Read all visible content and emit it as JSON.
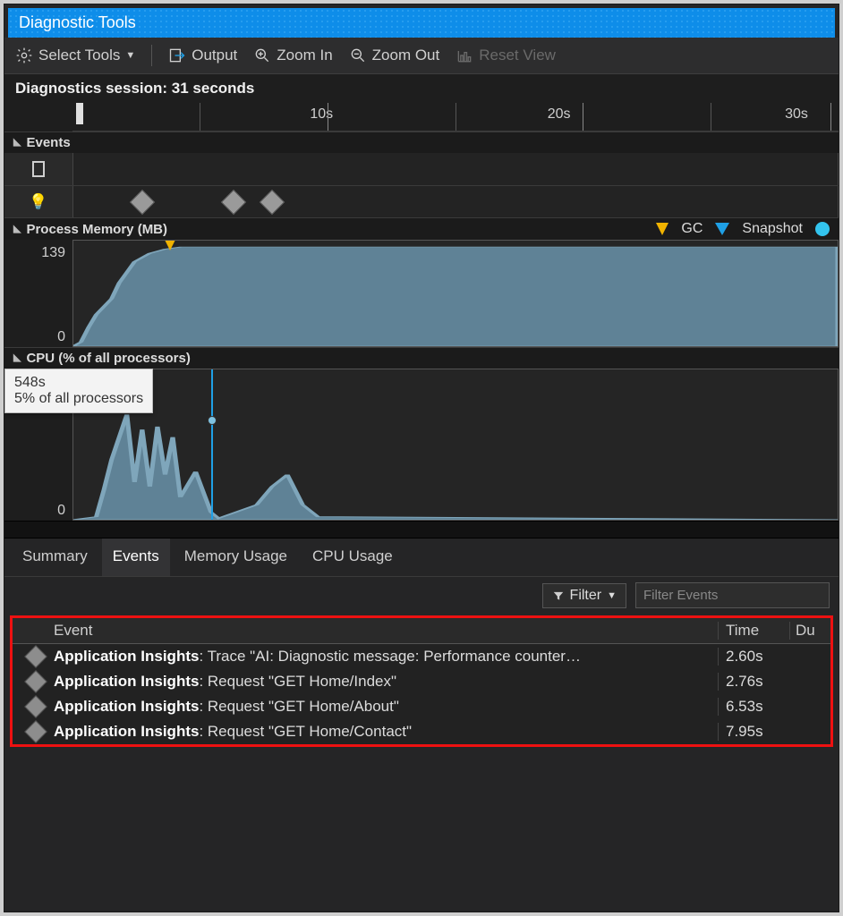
{
  "window": {
    "title": "Diagnostic Tools"
  },
  "toolbar": {
    "select_tools": "Select Tools",
    "output": "Output",
    "zoom_in": "Zoom In",
    "zoom_out": "Zoom Out",
    "reset_view": "Reset View"
  },
  "session": {
    "label": "Diagnostics session: 31 seconds"
  },
  "ruler": {
    "ticks": [
      "10s",
      "20s",
      "30s"
    ]
  },
  "sections": {
    "events": "Events",
    "memory": "Process Memory (MB)",
    "cpu": "CPU (% of all processors)"
  },
  "legend": {
    "gc": "GC",
    "snapshot": "Snapshot"
  },
  "memory": {
    "ymax": "139",
    "ymin": "0"
  },
  "cpu": {
    "ymin": "0"
  },
  "tooltip": {
    "line1": "548s",
    "line2": "5% of all processors"
  },
  "tabs": {
    "summary": "Summary",
    "events": "Events",
    "memory_usage": "Memory Usage",
    "cpu_usage": "CPU Usage"
  },
  "filter": {
    "label": "Filter",
    "placeholder": "Filter Events"
  },
  "table": {
    "headers": {
      "event": "Event",
      "time": "Time",
      "dur": "Du"
    },
    "prefix": "Application Insights",
    "rows": [
      {
        "text": ": Trace \"AI: Diagnostic message: Performance counter…",
        "time": "2.60s"
      },
      {
        "text": ": Request \"GET Home/Index\"",
        "time": "2.76s"
      },
      {
        "text": ": Request \"GET Home/About\"",
        "time": "6.53s"
      },
      {
        "text": ": Request \"GET Home/Contact\"",
        "time": "7.95s"
      }
    ]
  },
  "chart_data": [
    {
      "type": "area",
      "title": "Process Memory (MB)",
      "ylabel": "MB",
      "ylim": [
        0,
        139
      ],
      "x": [
        0,
        1,
        2,
        3,
        4,
        5,
        6,
        7,
        8,
        31
      ],
      "values": [
        0,
        35,
        70,
        95,
        115,
        128,
        135,
        138,
        139,
        139
      ],
      "markers": [
        {
          "type": "GC",
          "x": 4.5
        }
      ]
    },
    {
      "type": "area",
      "title": "CPU (% of all processors)",
      "ylabel": "%",
      "ylim": [
        0,
        30
      ],
      "x": [
        0,
        1,
        1.5,
        2,
        2.5,
        3,
        3.5,
        4,
        4.5,
        5,
        5.5,
        6,
        7,
        8,
        9,
        10,
        11,
        31
      ],
      "values": [
        0,
        5,
        12,
        25,
        8,
        20,
        10,
        22,
        12,
        18,
        5,
        2,
        0,
        4,
        8,
        5,
        1,
        0
      ],
      "cursor": {
        "x": 5.5,
        "label": "548s",
        "value_label": "5% of all processors"
      }
    }
  ]
}
